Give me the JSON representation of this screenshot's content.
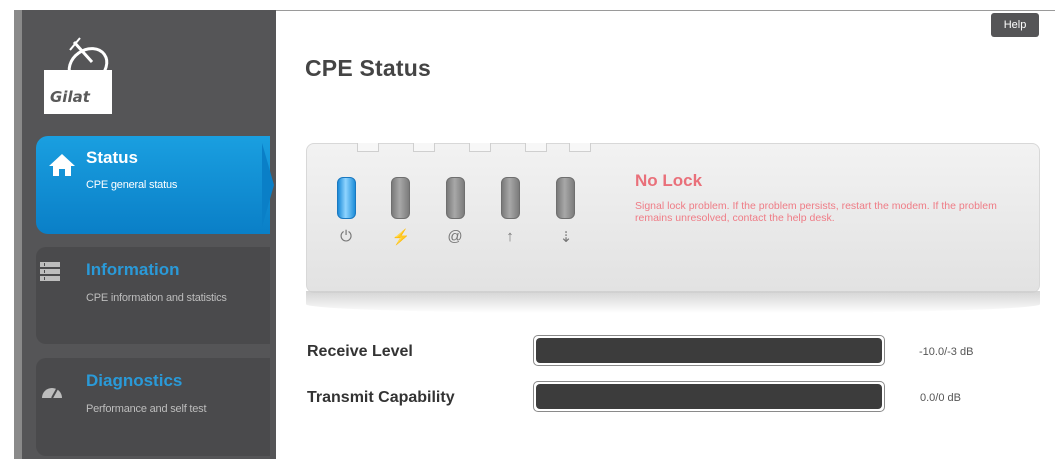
{
  "brand": {
    "logo_text": "Gilat"
  },
  "help_label": "Help",
  "page_title": "CPE Status",
  "nav": [
    {
      "title": "Status",
      "subtitle": "CPE general status",
      "icon": "home-icon",
      "active": true
    },
    {
      "title": "Information",
      "subtitle": "CPE information and statistics",
      "icon": "list-icon",
      "active": false
    },
    {
      "title": "Diagnostics",
      "subtitle": "Performance and self test",
      "icon": "gauge-icon",
      "active": false
    }
  ],
  "status_panel": {
    "leds": [
      {
        "name": "power",
        "icon": "power-icon",
        "glyph": "⏻",
        "on": true
      },
      {
        "name": "satellite",
        "icon": "satellite-icon",
        "glyph": "⚡",
        "on": false
      },
      {
        "name": "internet",
        "icon": "at-icon",
        "glyph": "@",
        "on": false
      },
      {
        "name": "transmit",
        "icon": "arrow-up-icon",
        "glyph": "↑",
        "on": false
      },
      {
        "name": "receive",
        "icon": "arrow-down-icon",
        "glyph": "⇣",
        "on": false
      }
    ],
    "lock_title": "No Lock",
    "lock_message": "Signal lock problem. If the problem persists, restart the modem. If the problem remains unresolved, contact the help desk."
  },
  "levels": {
    "receive": {
      "label": "Receive Level",
      "value": "-10.0/-3 dB"
    },
    "transmit": {
      "label": "Transmit Capability",
      "value": "0.0/0 dB"
    }
  },
  "colors": {
    "accent": "#0a7fc7",
    "sidebar": "#555557",
    "error": "#e9707a"
  }
}
